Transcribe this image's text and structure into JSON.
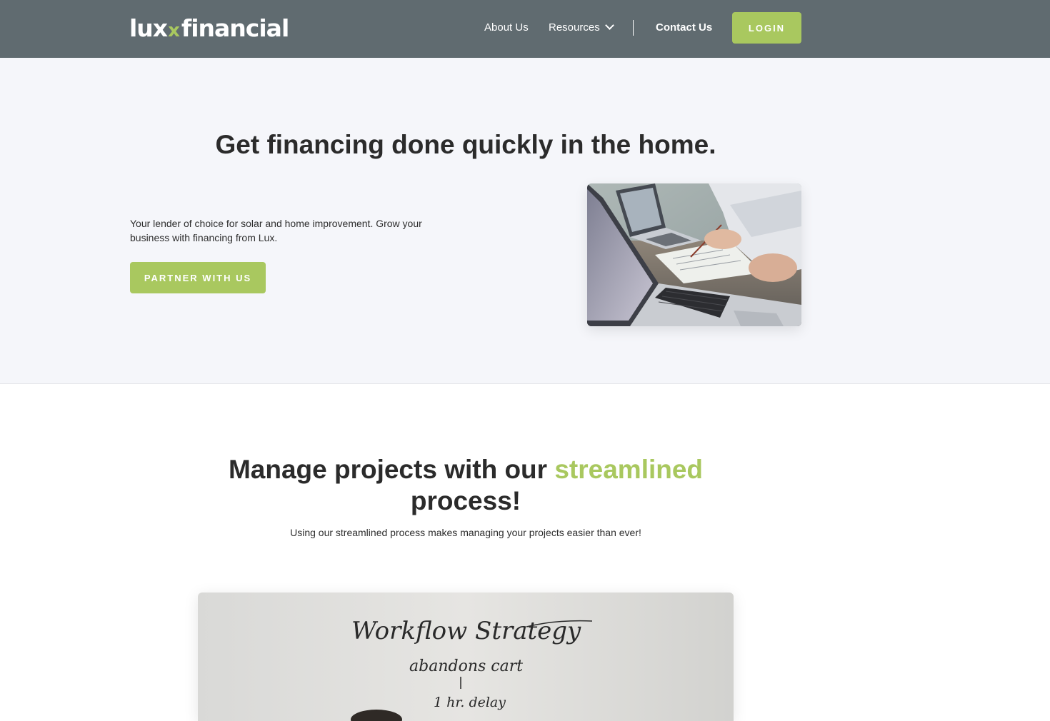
{
  "nav": {
    "logo_left": "lux",
    "logo_x": "x",
    "logo_right": "financial",
    "about_label": "About Us",
    "resources_label": "Resources",
    "contact_label": "Contact Us",
    "login_label": "LOGIN"
  },
  "hero": {
    "title": "Get financing done quickly in the home.",
    "description": "Your lender of choice for solar and home improvement. Grow your business with financing from Lux.",
    "cta_label": "PARTNER WITH US"
  },
  "process": {
    "title_part1": "Manage projects with our ",
    "title_accent": "streamlined",
    "title_part2": "process!",
    "subtitle": "Using our streamlined process makes managing your projects easier than ever!",
    "whiteboard_line1": "Workflow  Strategy",
    "whiteboard_line2": "abandons cart",
    "whiteboard_line3": "1 hr. delay"
  },
  "colors": {
    "nav_bg": "#606b70",
    "accent": "#a9c85f",
    "hero_bg": "#f5f6fa",
    "text": "#2b2b2b"
  }
}
